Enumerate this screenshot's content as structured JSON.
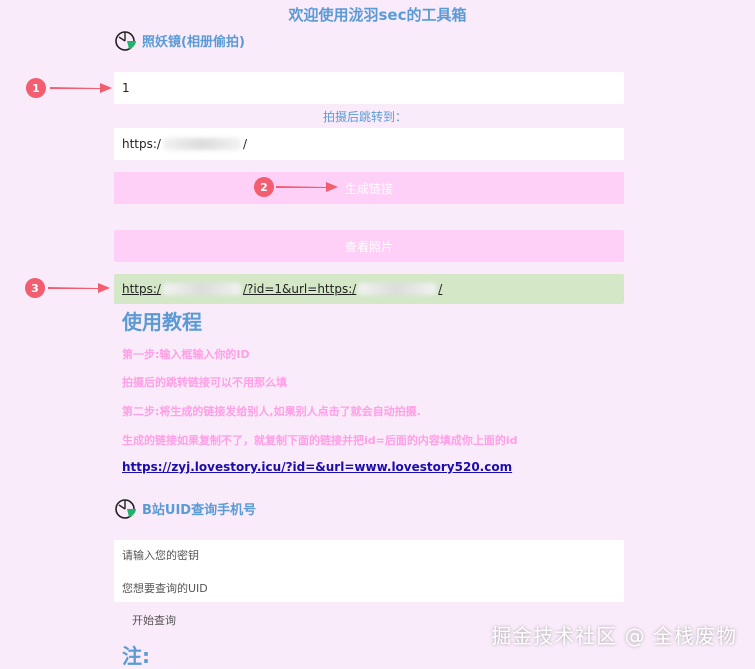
{
  "header": {
    "title": "欢迎使用泷羽sec的工具箱"
  },
  "camera_tool": {
    "label": "照妖镜(相册偷拍)",
    "id_value": "1",
    "redirect_label": "拍摄后跳转到：",
    "redirect_prefix": "https:/",
    "redirect_suffix": "/",
    "generate_button": "生成链接",
    "view_button": "查看照片",
    "result_link": {
      "part1": "https:/",
      "part2": "/?id=1&url=https:/",
      "part3": "/"
    }
  },
  "markers": [
    "1",
    "2",
    "3"
  ],
  "tutorial": {
    "heading": "使用教程",
    "steps": [
      "第一步:输入框输入你的ID",
      "拍摄后的跳转链接可以不用那么填",
      "第二步:将生成的链接发给别人,如果别人点击了就会自动拍摄.",
      "生成的链接如果复制不了，就复制下面的链接并把id=后面的内容填成你上面的id"
    ],
    "link": "https://zyj.lovestory.icu/?id=&url=www.lovestory520.com"
  },
  "bili_tool": {
    "label": "B站UID查询手机号",
    "key_placeholder": "请输入您的密钥",
    "uid_placeholder": "您想要查询的UID",
    "query_button": "开始查询"
  },
  "footer": {
    "note_heading": "注:"
  },
  "watermark": "掘金技术社区 @ 全栈废物",
  "colors": {
    "background": "#faebfa",
    "accent": "#5b9bd5",
    "button": "#ffd0f7",
    "result": "#d4e8c8",
    "marker": "#f25d6f",
    "step_text": "#ff9fe5"
  },
  "icons": {
    "section": "camera-pie-icon",
    "arrow": "arrow-right-icon"
  }
}
